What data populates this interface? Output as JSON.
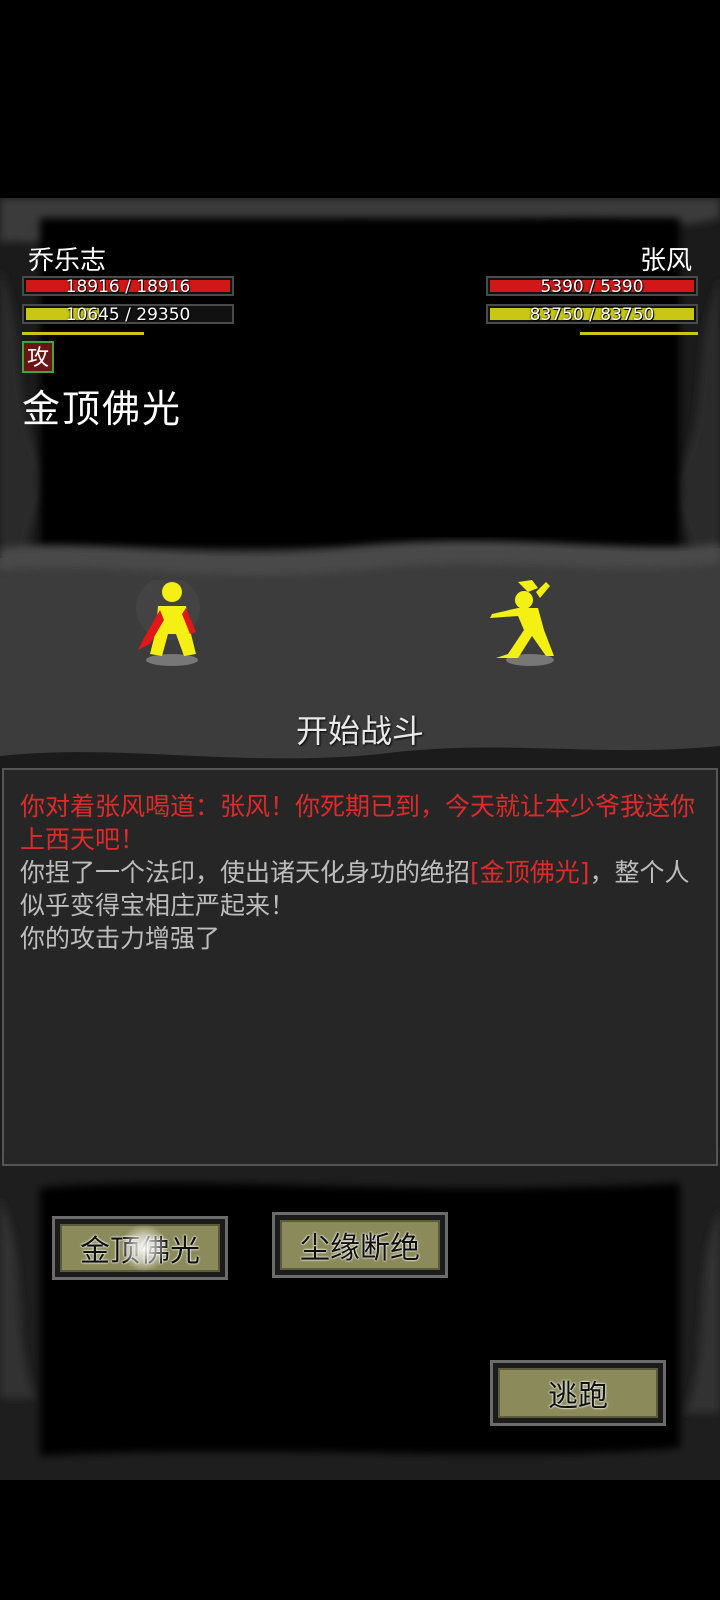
{
  "player": {
    "name": "乔乐志",
    "hp_text": "18916 / 18916",
    "hp_fraction": 1.0,
    "mp_text": "10645 / 29350",
    "mp_fraction": 0.36,
    "buff_badge": "攻",
    "skill_display": "金顶佛光"
  },
  "enemy": {
    "name": "张风",
    "hp_text": "5390 / 5390",
    "hp_fraction": 1.0,
    "mp_text": "83750 / 83750",
    "mp_fraction": 1.0
  },
  "battle_label": "开始战斗",
  "log": {
    "line1": "你对着张风喝道：张风！你死期已到，今天就让本少爷我送你上西天吧！",
    "line2_prefix": "你捏了一个法印，使出诸天化身功的绝招",
    "line2_skill": "[金顶佛光]",
    "line2_suffix": "，整个人似乎变得宝相庄严起来！",
    "line3": "你的攻击力增强了"
  },
  "actions": {
    "skill1": "金顶佛光",
    "skill2": "尘缘断绝",
    "flee": "逃跑"
  },
  "colors": {
    "hp": "#d01818",
    "mp": "#c8c814",
    "figure": "#f5f014",
    "log_red": "#e02a2a"
  }
}
